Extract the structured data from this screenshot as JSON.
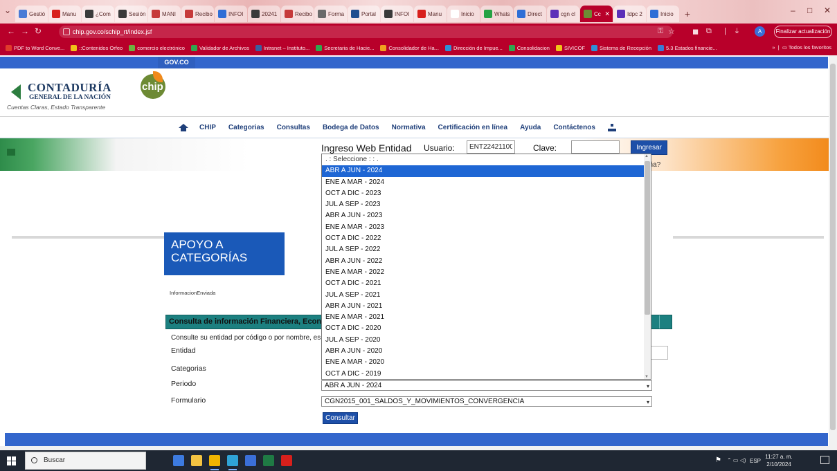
{
  "browser": {
    "tabs": [
      {
        "label": "Gestió",
        "color": "#4a7bd6"
      },
      {
        "label": "Manu",
        "color": "#d8201c"
      },
      {
        "label": "¿Com",
        "color": "#3a3a3a"
      },
      {
        "label": "Sesión",
        "color": "#3a3a3a"
      },
      {
        "label": "MANI",
        "color": "#c63a3a"
      },
      {
        "label": "Recibo",
        "color": "#c63a3a"
      },
      {
        "label": "INFOI",
        "color": "#2f6ed6"
      },
      {
        "label": "20241",
        "color": "#3a3a3a"
      },
      {
        "label": "Recibo",
        "color": "#c63a3a"
      },
      {
        "label": "Forma",
        "color": "#6a6a6a"
      },
      {
        "label": "Portal",
        "color": "#1f4d8f"
      },
      {
        "label": "INFOI",
        "color": "#3a3a3a"
      },
      {
        "label": "Manu",
        "color": "#d8201c"
      },
      {
        "label": "Inicio",
        "color": "#ffffff"
      },
      {
        "label": "Whats",
        "color": "#25a244"
      },
      {
        "label": "Direct",
        "color": "#2f6ed6"
      },
      {
        "label": "cgn cl",
        "color": "#5c2fb8"
      },
      {
        "label": "Cc",
        "color": "#6d8a34",
        "active": true
      },
      {
        "label": "Idpc 2",
        "color": "#5c2fb8"
      },
      {
        "label": "Inicio",
        "color": "#2f6ed6"
      }
    ],
    "new_tab": "+",
    "window_controls": {
      "minimize": "–",
      "maximize": "□",
      "close": "✕"
    },
    "url": "chip.gov.co/schip_rt/index.jsf",
    "update_button": "Finalizar actualización",
    "avatar_letter": "A",
    "bookmarks": [
      {
        "label": "PDF to Word Conve...",
        "color": "#e03c2c"
      },
      {
        "label": "::Contenidos Orfeo",
        "color": "#f0c419"
      },
      {
        "label": "comercio electrónico",
        "color": "#6db33f"
      },
      {
        "label": "Validador de Archivos",
        "color": "#2fa84f"
      },
      {
        "label": "Intranet – Instituto...",
        "color": "#3a5fa0"
      },
      {
        "label": "Secretaria de Hacie...",
        "color": "#2fa84f"
      },
      {
        "label": "Consolidador de Ha...",
        "color": "#f0a21f"
      },
      {
        "label": "Dirección de Impue...",
        "color": "#2f8fd6"
      },
      {
        "label": "Consolidacion",
        "color": "#2fa84f"
      },
      {
        "label": "SIVICOF",
        "color": "#f0c419"
      },
      {
        "label": "Sistema de Recepción",
        "color": "#2f8fd6"
      },
      {
        "label": "5.3 Estados financie...",
        "color": "#3a7bd6"
      }
    ],
    "bookmarks_more": "»",
    "bookmarks_all": "Todos los favoritos"
  },
  "page": {
    "gov_label": "GOV.CO",
    "logo": {
      "name": "CONTADURÍA",
      "sub": "GENERAL DE LA NACIÓN",
      "slogan": "Cuentas Claras, Estado Transparente",
      "chip": "chip"
    },
    "nav": [
      "CHIP",
      "Categorias",
      "Consultas",
      "Bodega de Datos",
      "Normativa",
      "Certificación en línea",
      "Ayuda",
      "Contáctenos"
    ],
    "login": {
      "title": "Ingreso Web Entidad",
      "user_label": "Usuario:",
      "user_value": "ENT22421100",
      "pass_label": "Clave:",
      "button": "Ingresar",
      "forgot_fragment": "eña?"
    },
    "apoyo_title": "APOYO A CATEGORÍAS",
    "info_enviada": "InformacionEnviada",
    "consulta": {
      "header": "Consulta de información Financiera, Econ",
      "description": "Consulte su entidad por código o por nombre, es",
      "labels": {
        "entidad": "Entidad",
        "categorias": "Categorias",
        "periodo": "Periodo",
        "formulario": "Formulario"
      },
      "periodo_value": "ABR A JUN - 2024",
      "formulario_value": "CGN2015_001_SALDOS_Y_MOVIMIENTOS_CONVERGENCIA",
      "button": "Consultar"
    },
    "dropdown": {
      "placeholder": ". : Seleccione : : .",
      "selected_index": 0,
      "options": [
        "ABR A JUN - 2024",
        "ENE A MAR - 2024",
        "OCT A DIC - 2023",
        "JUL A SEP - 2023",
        "ABR A JUN - 2023",
        "ENE A MAR - 2023",
        "OCT A DIC - 2022",
        "JUL A SEP - 2022",
        "ABR A JUN - 2022",
        "ENE A MAR - 2022",
        "OCT A DIC - 2021",
        "JUL A SEP - 2021",
        "ABR A JUN - 2021",
        "ENE A MAR - 2021",
        "OCT A DIC - 2020",
        "JUL A SEP - 2020",
        "ABR A JUN - 2020",
        "ENE A MAR - 2020",
        "OCT A DIC - 2019"
      ]
    }
  },
  "taskbar": {
    "search_placeholder": "Buscar",
    "apps": [
      {
        "name": "explorer",
        "color": "#3d7be0"
      },
      {
        "name": "files",
        "color": "#f3c342"
      },
      {
        "name": "chrome",
        "color": "#f0b400"
      },
      {
        "name": "edge",
        "color": "#2fa3d6"
      },
      {
        "name": "app-blue",
        "color": "#3b6fd8"
      },
      {
        "name": "excel",
        "color": "#1f7a44"
      },
      {
        "name": "acrobat",
        "color": "#d8201c"
      }
    ],
    "language": "ESP",
    "time": "11:27 a. m.",
    "date": "2/10/2024"
  },
  "colors": {
    "chrome_red": "#b8002a",
    "gov_blue": "#3366cc",
    "nav_blue": "#1f3f7a",
    "teal_header": "#1c8080",
    "selected_option": "#1e66d4"
  }
}
